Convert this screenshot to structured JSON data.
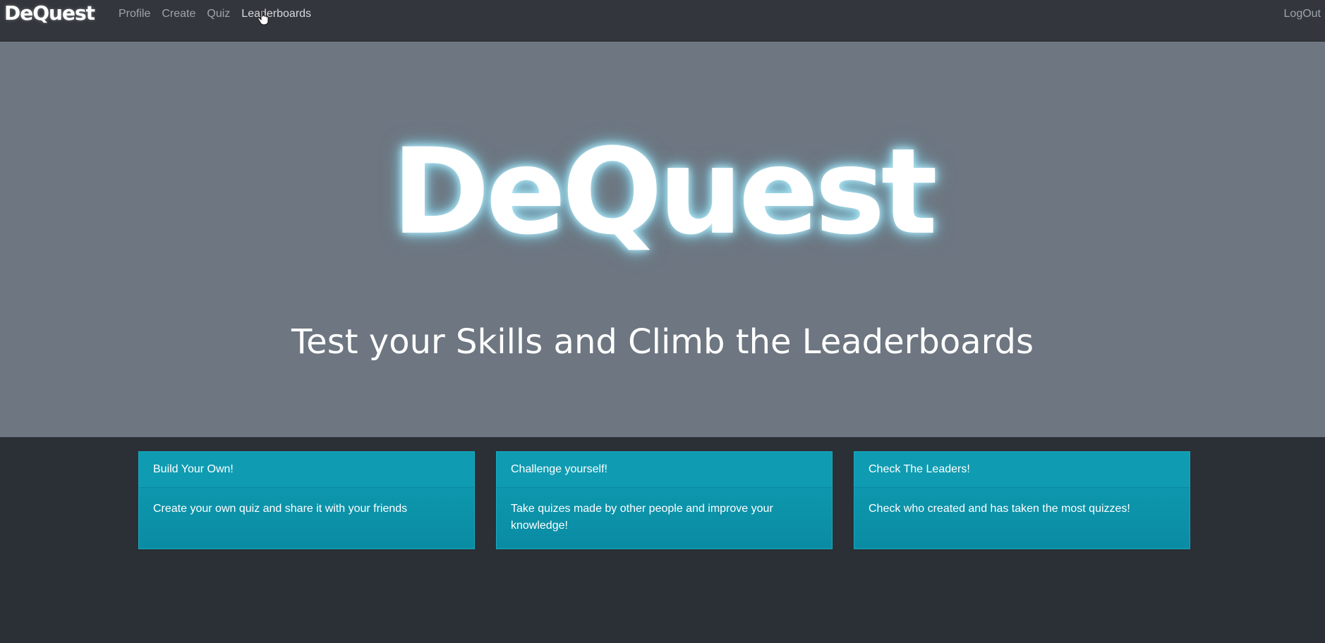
{
  "navbar": {
    "brand": "DeQuest",
    "links": [
      {
        "label": "Profile"
      },
      {
        "label": "Create"
      },
      {
        "label": "Quiz"
      },
      {
        "label": "Leaderboards"
      }
    ],
    "logout": "LogOut"
  },
  "hero": {
    "logo_text": "DeQuest",
    "tagline": "Test your Skills and Climb the Leaderboards"
  },
  "cards": [
    {
      "title": "Build Your Own!",
      "body": "Create your own quiz and share it with your friends"
    },
    {
      "title": "Challenge yourself!",
      "body": "Take quizes made by other people and improve your knowledge!"
    },
    {
      "title": "Check The Leaders!",
      "body": "Check who created and has taken the most quizzes!"
    }
  ],
  "colors": {
    "navbar_bg": "#33373d",
    "hero_bg": "#6d7681",
    "page_bg": "#2b2f36",
    "card_bg": "#0f9db3"
  }
}
